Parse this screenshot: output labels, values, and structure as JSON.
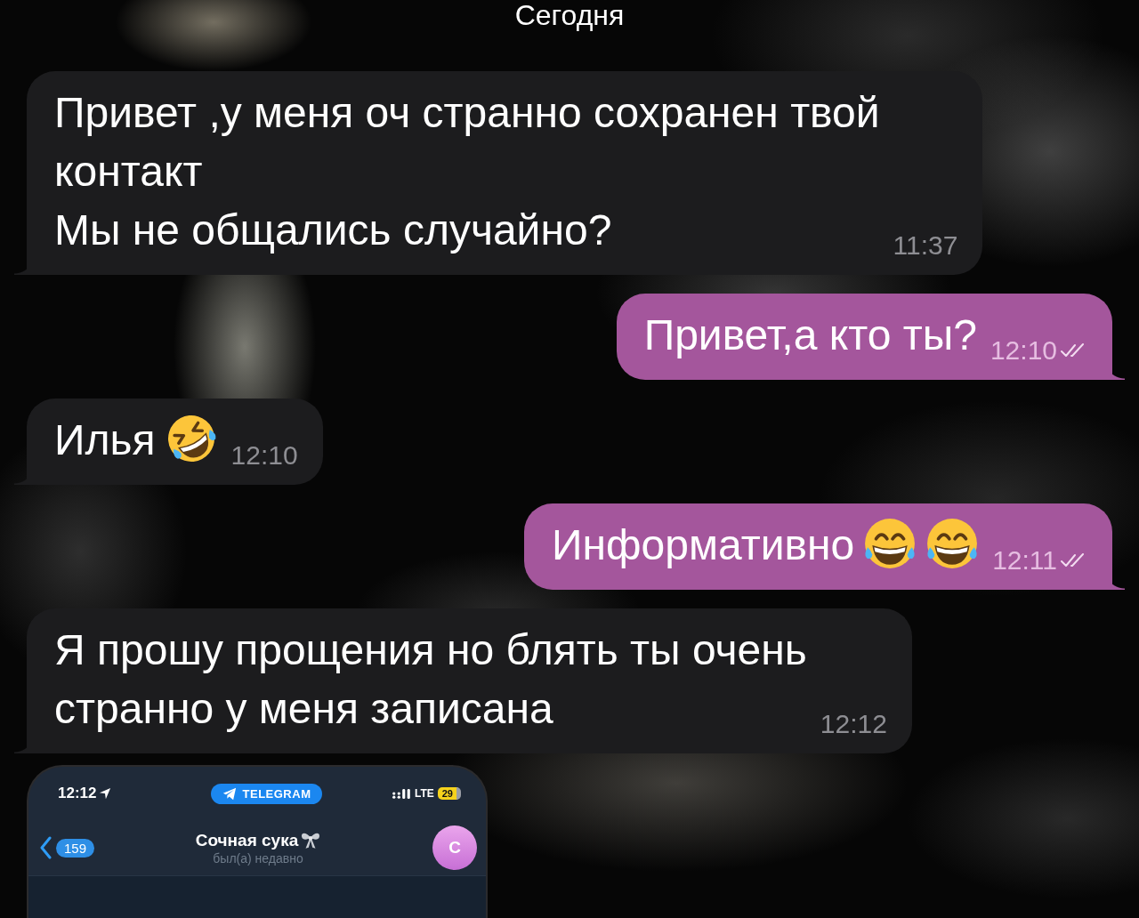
{
  "date_label": "Сегодня",
  "messages": [
    {
      "kind": "incoming",
      "parts": [
        {
          "kind": "text",
          "text": "Привет ,у меня оч странно сохранен твой\nконтакт\nМы не общались случайно?"
        }
      ],
      "time": "11:37"
    },
    {
      "kind": "outgoing",
      "parts": [
        {
          "kind": "text",
          "text": "Привет,а кто ты?"
        }
      ],
      "time": "12:10",
      "read": true
    },
    {
      "kind": "incoming",
      "parts": [
        {
          "kind": "text",
          "text": "Илья"
        },
        {
          "kind": "rofl"
        }
      ],
      "time": "12:10"
    },
    {
      "kind": "outgoing",
      "parts": [
        {
          "kind": "text",
          "text": "Информативно"
        },
        {
          "kind": "joy"
        },
        {
          "kind": "joy"
        }
      ],
      "time": "12:11",
      "read": true
    },
    {
      "kind": "incoming",
      "parts": [
        {
          "kind": "text",
          "text": "Я прошу прощения но блять ты очень\nстранно у меня записана"
        }
      ],
      "time": "12:12"
    }
  ],
  "attachment": {
    "kind": "screenshot",
    "status_bar": {
      "time": "12:12",
      "app_pill": "TELEGRAM",
      "network": "LTE",
      "battery": "29"
    },
    "chat_header": {
      "unread_count": "159",
      "title": "Сочная сука",
      "subtitle": "был(а) недавно",
      "avatar_letter": "С"
    }
  }
}
